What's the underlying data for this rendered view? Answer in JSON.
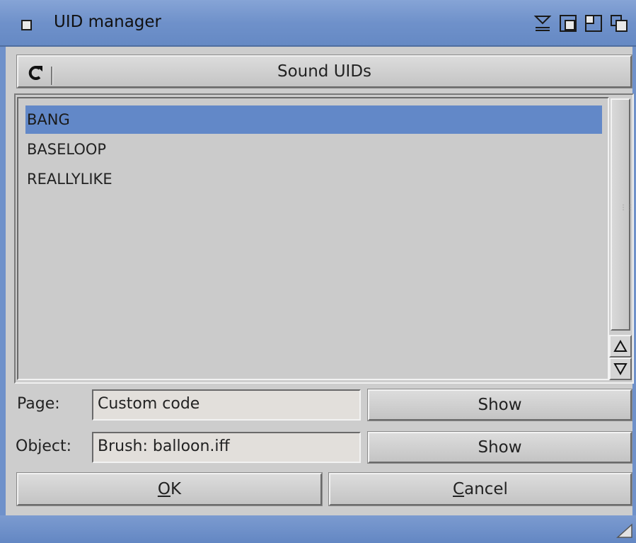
{
  "window": {
    "title": "UID manager"
  },
  "cycle": {
    "label": "Sound UIDs"
  },
  "list": {
    "items": [
      "BANG",
      "BASELOOP",
      "REALLYLIKE"
    ],
    "selected_index": 0
  },
  "page": {
    "label": "Page:",
    "value": "Custom code",
    "show_label": "Show"
  },
  "object": {
    "label": "Object:",
    "value": "Brush: balloon.iff",
    "show_label": "Show"
  },
  "buttons": {
    "ok_label": "OK",
    "ok_mnemonic": "O",
    "ok_rest": "K",
    "cancel_label": "Cancel",
    "cancel_mnemonic": "C",
    "cancel_rest": "ancel"
  },
  "icons": {
    "close": "close-icon",
    "iconify": "iconify-icon",
    "zoom": "zoom-icon",
    "snapshot": "snapshot-icon",
    "depth": "depth-icon",
    "cycle": "cycle-icon",
    "scroll_up": "arrow-up-icon",
    "scroll_down": "arrow-down-icon",
    "resize": "resize-icon"
  },
  "colors": {
    "titlebar": "#6f91ca",
    "selection": "#6288c8",
    "background": "#cdcdcd"
  }
}
